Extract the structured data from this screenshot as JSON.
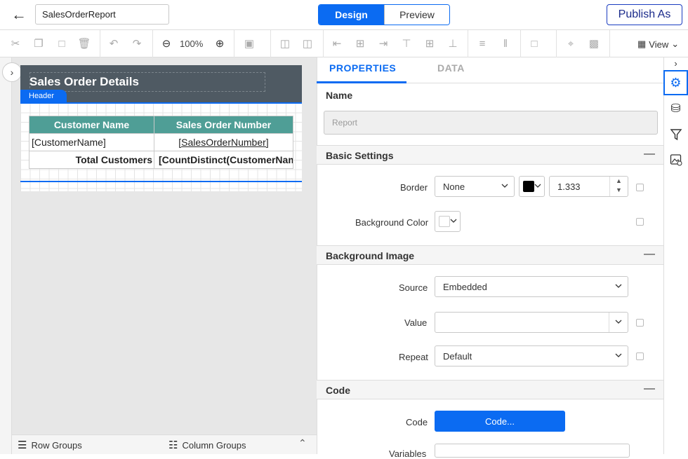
{
  "topbar": {
    "report_name": "SalesOrderReport",
    "design_label": "Design",
    "preview_label": "Preview",
    "publish_label": "Publish As"
  },
  "toolbar": {
    "zoom": "100%",
    "view_label": "View"
  },
  "report": {
    "title": "Sales Order Details",
    "header_tag": "Header",
    "columns": [
      "Customer Name",
      "Sales Order Number"
    ],
    "row": [
      "[CustomerName]",
      "[SalesOrderNumber]"
    ],
    "total_label": "Total Customers",
    "total_value": "[CountDistinct(CustomerName)]"
  },
  "bottombar": {
    "row_groups": "Row Groups",
    "column_groups": "Column Groups"
  },
  "properties": {
    "tab_properties": "PROPERTIES",
    "tab_data": "DATA",
    "name_label": "Name",
    "name_placeholder": "Report",
    "basic_settings": "Basic Settings",
    "border_label": "Border",
    "border_value": "None",
    "border_width": "1.333",
    "background_color_label": "Background Color",
    "background_image": "Background Image",
    "source_label": "Source",
    "source_value": "Embedded",
    "value_label": "Value",
    "repeat_label": "Repeat",
    "repeat_value": "Default",
    "code_section": "Code",
    "code_label": "Code",
    "code_button": "Code...",
    "variables_label": "Variables"
  },
  "colors": {
    "accent": "#0b6bf2",
    "header_band": "#4f5a63",
    "table_header": "#4f9e96"
  }
}
